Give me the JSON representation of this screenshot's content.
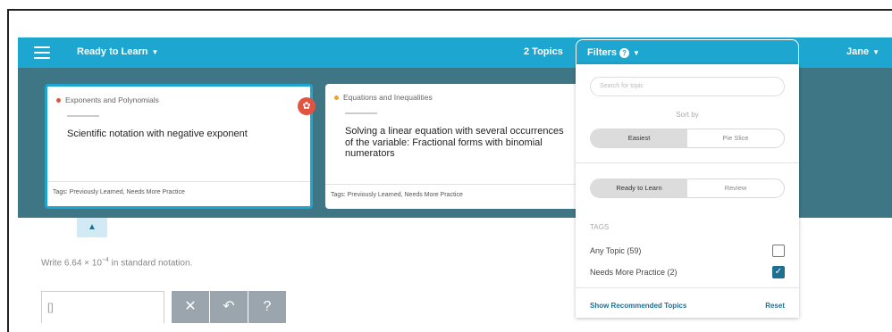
{
  "header": {
    "mode_label": "Ready to Learn",
    "topics_count": "2 Topics",
    "filters_label": "Filters",
    "user_name": "Jane"
  },
  "cards": [
    {
      "category": "Exponents and Polynomials",
      "title": "Scientific notation with negative exponent",
      "tags": "Tags: Previously Learned, Needs More Practice",
      "selected": true,
      "dot_color": "#e2543f"
    },
    {
      "category": "Equations and Inequalities",
      "title": "Solving a linear equation with several occurrences of the variable: Fractional forms with binomial numerators",
      "tags": "Tags: Previously Learned, Needs More Practice",
      "selected": false,
      "dot_color": "#f0a030"
    }
  ],
  "question": {
    "prefix": "Write 6.64 × 10",
    "exponent": "−4",
    "suffix": " in standard notation.",
    "answer_value": "[]"
  },
  "tools": [
    "✕",
    "↶",
    "?"
  ],
  "filters_panel": {
    "search_placeholder": "Search for topic",
    "sort_by_label": "Sort by",
    "sort_options": [
      "Easiest",
      "Pie Slice"
    ],
    "sort_selected": "Easiest",
    "mode_options": [
      "Ready to Learn",
      "Review"
    ],
    "mode_selected": "Ready to Learn",
    "tags_header": "TAGS",
    "tags": [
      {
        "label": "Any Topic (59)",
        "checked": false
      },
      {
        "label": "Needs More Practice (2)",
        "checked": true
      }
    ],
    "show_recommended": "Show Recommended Topics",
    "reset": "Reset"
  },
  "colors": {
    "accent": "#1da6cf",
    "band": "#3f7686",
    "link": "#1f6f91"
  }
}
